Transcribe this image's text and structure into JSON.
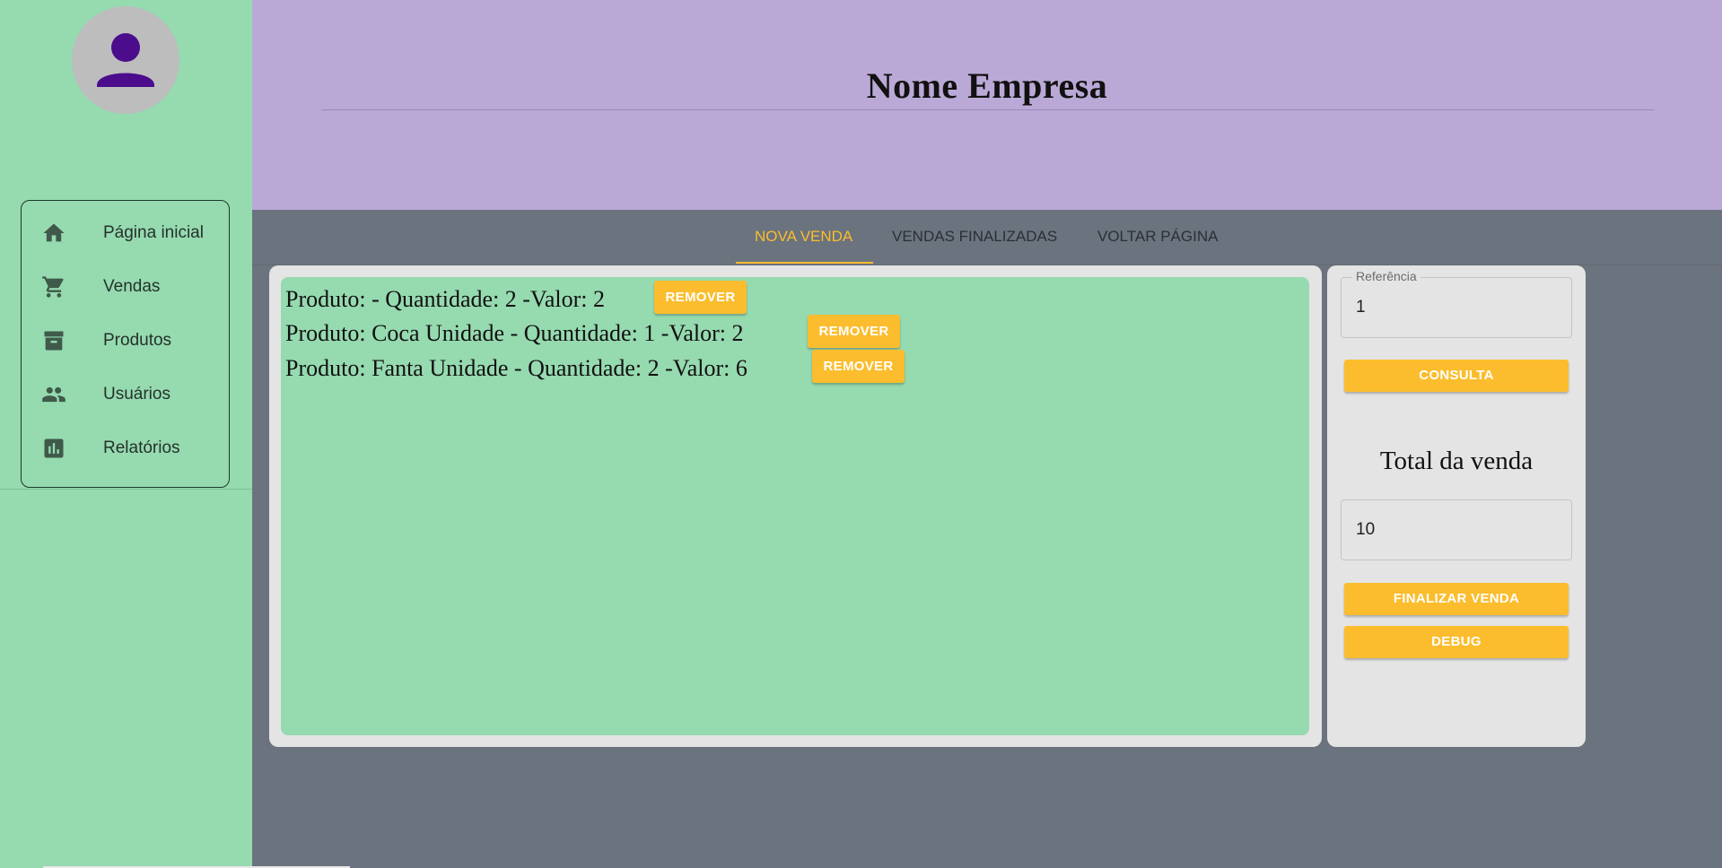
{
  "sidebar": {
    "items": [
      {
        "label": "Página inicial",
        "icon": "home-icon"
      },
      {
        "label": "Vendas",
        "icon": "cart-icon"
      },
      {
        "label": "Produtos",
        "icon": "archive-icon"
      },
      {
        "label": "Usuários",
        "icon": "people-icon"
      },
      {
        "label": "Relatórios",
        "icon": "bar-chart-icon"
      }
    ]
  },
  "header": {
    "title": "Nome Empresa"
  },
  "tabs": [
    {
      "label": "NOVA VENDA",
      "active": true
    },
    {
      "label": "VENDAS FINALIZADAS",
      "active": false
    },
    {
      "label": "VOLTAR PÁGINA",
      "active": false
    }
  ],
  "sale_items": [
    {
      "text": "Produto: - Quantidade: 2 -Valor: 2",
      "button": "REMOVER"
    },
    {
      "text": "Produto: Coca Unidade - Quantidade: 1 -Valor: 2",
      "button": "REMOVER"
    },
    {
      "text": "Produto: Fanta Unidade - Quantidade: 2 -Valor: 6",
      "button": "REMOVER"
    }
  ],
  "sidepanel": {
    "reference_label": "Referência",
    "reference_value": "1",
    "consult_label": "CONSULTA",
    "total_title": "Total da venda",
    "total_value": "10",
    "finalize_label": "FINALIZAR VENDA",
    "debug_label": "DEBUG"
  },
  "colors": {
    "sidebar_bg": "#96dab0",
    "header_bg": "#baa9d6",
    "accent": "#fbbd2d",
    "content_bg": "#6b737e",
    "avatar_person": "#4b0d8c"
  }
}
